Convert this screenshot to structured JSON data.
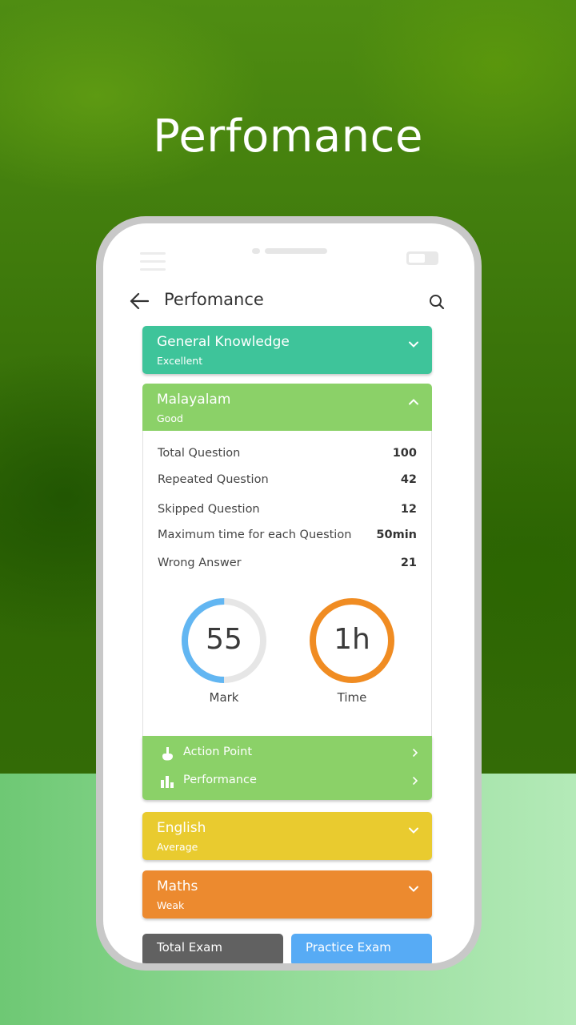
{
  "hero": {
    "title": "Perfomance"
  },
  "appbar": {
    "title": "Perfomance",
    "back_icon": "arrow-left",
    "search_icon": "search"
  },
  "subjects": [
    {
      "name": "General Knowledge",
      "rating": "Excellent",
      "color": "#3ec49a",
      "expanded": false
    },
    {
      "name": "Malayalam",
      "rating": "Good",
      "color": "#8bd168",
      "expanded": true
    },
    {
      "name": "English",
      "rating": "Average",
      "color": "#e9cb2f",
      "expanded": false
    },
    {
      "name": "Maths",
      "rating": "Weak",
      "color": "#ec8a2f",
      "expanded": false
    }
  ],
  "details": {
    "rows": [
      {
        "label": "Total Question",
        "value": "100"
      },
      {
        "label": "Repeated Question",
        "value": "42"
      },
      {
        "label": "Skipped Question",
        "value": "12"
      },
      {
        "label": "Maximum time for each Question",
        "value": "50min"
      },
      {
        "label": "Wrong Answer",
        "value": "21"
      }
    ],
    "mark": {
      "value": "55",
      "label": "Mark",
      "progress": 0.5,
      "color": "#62b6f2",
      "track": "#e6e6e6"
    },
    "time": {
      "value": "1h",
      "label": "Time",
      "progress": 1.0,
      "color": "#f08c22"
    }
  },
  "actions": [
    {
      "label": "Action Point",
      "icon": "hand-pointer"
    },
    {
      "label": "Performance",
      "icon": "bar-chart"
    }
  ],
  "buttons": {
    "total_exam": {
      "label": "Total Exam",
      "color": "#616161"
    },
    "practice_exam": {
      "label": "Practice Exam",
      "color": "#57abf5"
    }
  }
}
